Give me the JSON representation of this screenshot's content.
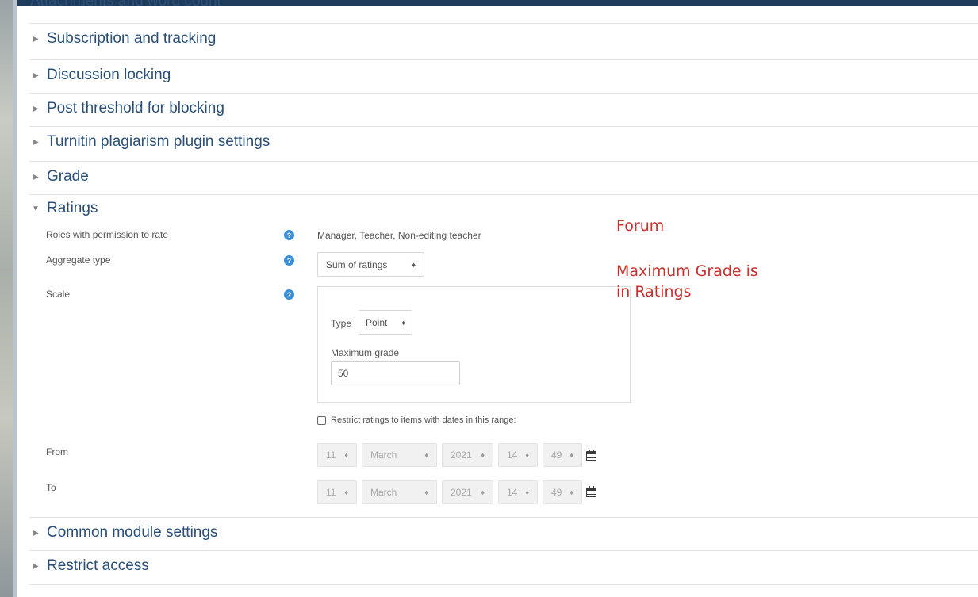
{
  "sections_top": [
    {
      "label": "Attachments and word count"
    },
    {
      "label": "Subscription and tracking"
    },
    {
      "label": "Discussion locking"
    },
    {
      "label": "Post threshold for blocking"
    },
    {
      "label": "Turnitin plagiarism plugin settings"
    },
    {
      "label": "Grade"
    }
  ],
  "ratings": {
    "heading": "Ratings",
    "roles_label": "Roles with permission to rate",
    "roles_value": "Manager, Teacher, Non-editing teacher",
    "aggregate_label": "Aggregate type",
    "aggregate_value": "Sum of ratings",
    "scale_label": "Scale",
    "type_label": "Type",
    "type_value": "Point",
    "max_grade_label": "Maximum grade",
    "max_grade_value": "50",
    "restrict_label": "Restrict ratings to items with dates in this range:",
    "from_label": "From",
    "to_label": "To",
    "from": {
      "day": "11",
      "month": "March",
      "year": "2021",
      "hour": "14",
      "minute": "49"
    },
    "to": {
      "day": "11",
      "month": "March",
      "year": "2021",
      "hour": "14",
      "minute": "49"
    }
  },
  "sections_bottom": [
    {
      "label": "Common module settings"
    },
    {
      "label": "Restrict access"
    }
  ],
  "annotation": {
    "line1": "Forum",
    "line2": "Maximum Grade is",
    "line3": "in Ratings"
  },
  "icons": {
    "collapsed": "triangle-right-icon",
    "expanded": "triangle-down-icon",
    "help": "question-circle-icon",
    "calendar": "calendar-icon",
    "select_caret": "updown-caret-icon"
  },
  "colors": {
    "heading": "#2a4f78",
    "annotation": "#c8322d",
    "help_icon": "#3b8fd6",
    "top_bar": "#1f3c5c"
  }
}
